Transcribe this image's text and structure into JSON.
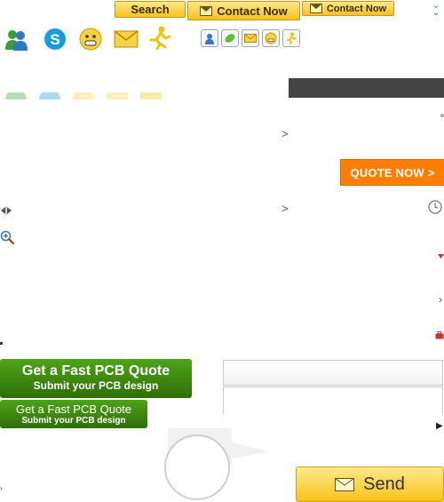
{
  "top_buttons": {
    "search_label": "Search",
    "contact_now_label": "Contact Now",
    "contact_now_small_label": "Contact Now"
  },
  "icons": {
    "messenger": "messenger-icon",
    "skype": "skype-icon",
    "smiley": "smiley-icon",
    "mail": "envelope-icon",
    "aim": "aim-runner-icon"
  },
  "quote_button": {
    "label": "QUOTE NOW >"
  },
  "arrows": {
    "arrow_1": ">",
    "arrow_2": ">",
    "arrow_right": "›"
  },
  "pcb_banner_large": {
    "title": "Get a Fast PCB Quote",
    "subtitle": "Submit your PCB design"
  },
  "pcb_banner_small": {
    "title": "Get a Fast PCB Quote",
    "subtitle": "Submit your PCB design"
  },
  "send_button": {
    "label": "Send"
  },
  "colors": {
    "accent_orange": "#ff7e00",
    "banner_green": "#3d8a10",
    "button_yellow": "#f7c21b",
    "dark_bar": "#444444"
  }
}
